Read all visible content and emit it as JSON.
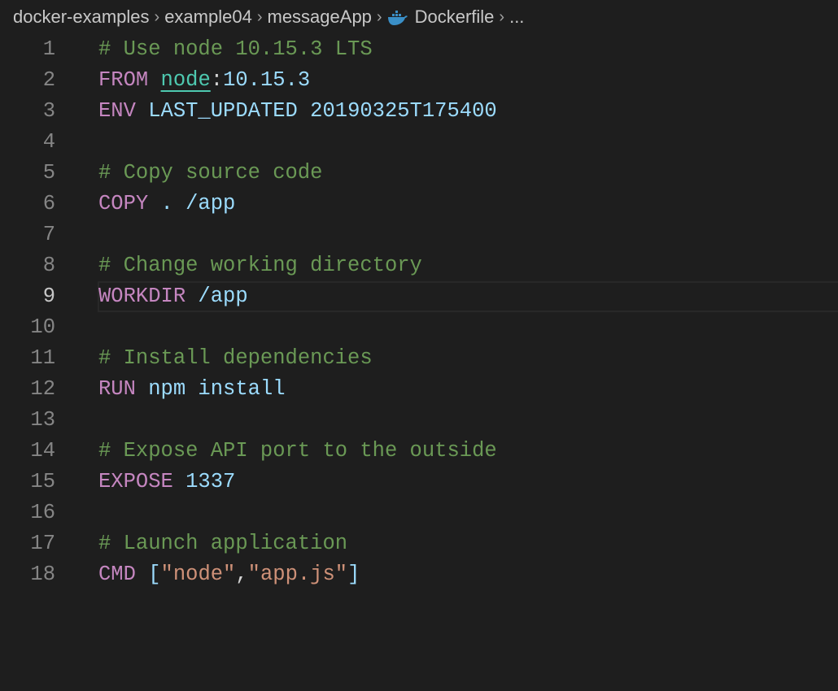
{
  "breadcrumb": [
    "docker-examples",
    "example04",
    "messageApp",
    "Dockerfile",
    "..."
  ],
  "icons": {
    "file": "docker-whale-icon"
  },
  "editor": {
    "current_line": 9,
    "lines": [
      {
        "n": "1",
        "tokens": [
          {
            "t": "# Use node 10.15.3 LTS",
            "c": "comment"
          }
        ]
      },
      {
        "n": "2",
        "tokens": [
          {
            "t": "FROM",
            "c": "kw"
          },
          {
            "t": " ",
            "c": "punc"
          },
          {
            "t": "node",
            "c": "img"
          },
          {
            "t": ":",
            "c": "punc"
          },
          {
            "t": "10.15.3",
            "c": "var"
          }
        ]
      },
      {
        "n": "3",
        "tokens": [
          {
            "t": "ENV",
            "c": "kw"
          },
          {
            "t": " LAST_UPDATED 20190325T175400",
            "c": "var"
          }
        ]
      },
      {
        "n": "4",
        "tokens": []
      },
      {
        "n": "5",
        "tokens": [
          {
            "t": "# Copy source code",
            "c": "comment"
          }
        ]
      },
      {
        "n": "6",
        "tokens": [
          {
            "t": "COPY",
            "c": "kw"
          },
          {
            "t": " . /app",
            "c": "var"
          }
        ]
      },
      {
        "n": "7",
        "tokens": []
      },
      {
        "n": "8",
        "tokens": [
          {
            "t": "# Change working directory",
            "c": "comment"
          }
        ]
      },
      {
        "n": "9",
        "tokens": [
          {
            "t": "WORKDIR",
            "c": "kw"
          },
          {
            "t": " /app",
            "c": "var"
          }
        ]
      },
      {
        "n": "10",
        "tokens": []
      },
      {
        "n": "11",
        "tokens": [
          {
            "t": "# Install dependencies",
            "c": "comment"
          }
        ]
      },
      {
        "n": "12",
        "tokens": [
          {
            "t": "RUN",
            "c": "kw"
          },
          {
            "t": " npm install",
            "c": "var"
          }
        ]
      },
      {
        "n": "13",
        "tokens": []
      },
      {
        "n": "14",
        "tokens": [
          {
            "t": "# Expose API port to the outside",
            "c": "comment"
          }
        ]
      },
      {
        "n": "15",
        "tokens": [
          {
            "t": "EXPOSE",
            "c": "kw"
          },
          {
            "t": " 1337",
            "c": "var"
          }
        ]
      },
      {
        "n": "16",
        "tokens": []
      },
      {
        "n": "17",
        "tokens": [
          {
            "t": "# Launch application",
            "c": "comment"
          }
        ]
      },
      {
        "n": "18",
        "tokens": [
          {
            "t": "CMD",
            "c": "kw"
          },
          {
            "t": " [",
            "c": "brk"
          },
          {
            "t": "\"node\"",
            "c": "str"
          },
          {
            "t": ",",
            "c": "punc"
          },
          {
            "t": "\"app.js\"",
            "c": "str"
          },
          {
            "t": "]",
            "c": "brk"
          }
        ]
      }
    ]
  }
}
